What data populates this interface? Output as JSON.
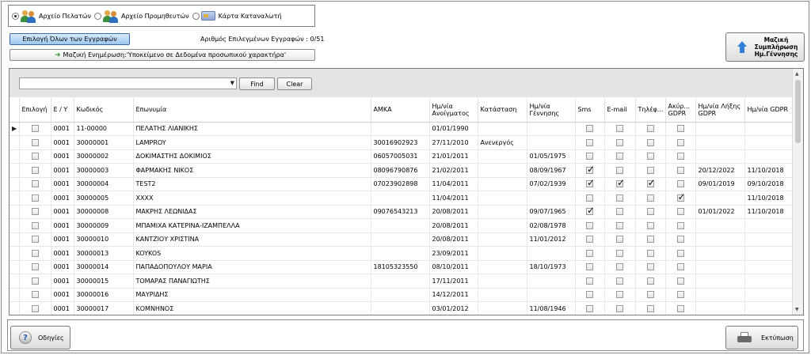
{
  "file_selector": {
    "options": [
      {
        "label": "Αρχείο Πελατών",
        "selected": true,
        "icon": "customers-icon"
      },
      {
        "label": "Αρχείο Προμηθευτών",
        "selected": false,
        "icon": "suppliers-icon"
      },
      {
        "label": "Κάρτα Καταναλωτή",
        "selected": false,
        "icon": "consumer-card-icon"
      }
    ]
  },
  "toolbar": {
    "select_all_label": "Επιλογή Όλων των Εγγραφών",
    "selected_count_label": "Αριθμός Επιλεγμένων Εγγραφών : 0/51",
    "mass_update_label": "Μαζική Ενημέρωση:'Υποκείμενο σε Δεδομένα προσωπικού χαρακτήρα'",
    "birthdate_button_label": "Μαζική Συμπλήρωση Ημ.Γέννησης"
  },
  "filter": {
    "value": "",
    "find_label": "Find",
    "clear_label": "Clear"
  },
  "columns": [
    "Επιλογή",
    "Ε / Υ",
    "Κωδικός",
    "Επωνυμία",
    "ΑΜΚΑ",
    "Ημ/νία Ανοίγματος",
    "Κατάσταση",
    "Ημ/νία Γέννησης",
    "Sms",
    "E-mail",
    "Τηλέφ...",
    "Ακύρ... GDPR",
    "Ημ/νία Λήξης GDPR",
    "Ημ/νία GDPR"
  ],
  "rows": [
    {
      "ey": "0001",
      "code": "11-00000",
      "name": "ΠΕΛΑΤΗΣ ΛΙΑΝΙΚΗΣ",
      "amka": "",
      "opened": "01/01/1990",
      "status": "",
      "birth": "",
      "sms": false,
      "email": false,
      "phone": false,
      "cancel": false,
      "gdpr_end": "",
      "gdpr_date": "",
      "current": true
    },
    {
      "ey": "0001",
      "code": "30000001",
      "name": "LAMPROY",
      "amka": "30016902923",
      "opened": "27/11/2010",
      "status": "Ανενεργός",
      "birth": "",
      "sms": false,
      "email": false,
      "phone": false,
      "cancel": false,
      "gdpr_end": "",
      "gdpr_date": ""
    },
    {
      "ey": "0001",
      "code": "30000002",
      "name": "ΔΟΚΙΜΑΣΤΗΣ ΔΟΚΙΜΙΟΣ",
      "amka": "06057005031",
      "opened": "21/01/2011",
      "status": "",
      "birth": "01/05/1975",
      "sms": false,
      "email": false,
      "phone": false,
      "cancel": false,
      "gdpr_end": "",
      "gdpr_date": ""
    },
    {
      "ey": "0001",
      "code": "30000003",
      "name": "ΦΑΡΜΑΚΗΣ ΝΙΚΟΣ",
      "amka": "08096790876",
      "opened": "21/02/2011",
      "status": "",
      "birth": "08/09/1967",
      "sms": true,
      "email": false,
      "phone": false,
      "cancel": false,
      "gdpr_end": "20/12/2022",
      "gdpr_date": "11/10/2018"
    },
    {
      "ey": "0001",
      "code": "30000004",
      "name": "TEST2",
      "amka": "07023902898",
      "opened": "11/04/2011",
      "status": "",
      "birth": "07/02/1939",
      "sms": true,
      "email": true,
      "phone": true,
      "cancel": false,
      "gdpr_end": "09/01/2019",
      "gdpr_date": "09/10/2018"
    },
    {
      "ey": "0001",
      "code": "30000005",
      "name": "XXXX",
      "amka": "",
      "opened": "11/04/2011",
      "status": "",
      "birth": "",
      "sms": false,
      "email": false,
      "phone": false,
      "cancel": true,
      "gdpr_end": "",
      "gdpr_date": "11/10/2018"
    },
    {
      "ey": "0001",
      "code": "30000008",
      "name": "ΜΑΚΡΗΣ ΛΕΩΝΙΔΑΣ",
      "amka": "09076543213",
      "opened": "20/08/2011",
      "status": "",
      "birth": "09/07/1965",
      "sms": true,
      "email": false,
      "phone": false,
      "cancel": false,
      "gdpr_end": "01/01/2022",
      "gdpr_date": "11/10/2018"
    },
    {
      "ey": "0001",
      "code": "30000009",
      "name": "ΜΠΑΜΙΧΑ ΚΑΤΕΡΙΝΑ-ΙΖΑΜΠΕΛΛΑ",
      "amka": "",
      "opened": "20/08/2011",
      "status": "",
      "birth": "02/08/1978",
      "sms": false,
      "email": false,
      "phone": false,
      "cancel": false,
      "gdpr_end": "",
      "gdpr_date": ""
    },
    {
      "ey": "0001",
      "code": "30000010",
      "name": "ΚΑΝΤΖΙΟΥ ΧΡΙΣΤΙΝΑ",
      "amka": "",
      "opened": "20/08/2011",
      "status": "",
      "birth": "11/01/2012",
      "sms": false,
      "email": false,
      "phone": false,
      "cancel": false,
      "gdpr_end": "",
      "gdpr_date": ""
    },
    {
      "ey": "0001",
      "code": "30000013",
      "name": "KOYKOS",
      "amka": "",
      "opened": "23/09/2011",
      "status": "",
      "birth": "",
      "sms": false,
      "email": false,
      "phone": false,
      "cancel": false,
      "gdpr_end": "",
      "gdpr_date": ""
    },
    {
      "ey": "0001",
      "code": "30000014",
      "name": "ΠΑΠΑΔΟΠΟΥΛΟΥ ΜΑΡΙΑ",
      "amka": "18105323550",
      "opened": "08/10/2011",
      "status": "",
      "birth": "18/10/1973",
      "sms": false,
      "email": false,
      "phone": false,
      "cancel": false,
      "gdpr_end": "",
      "gdpr_date": ""
    },
    {
      "ey": "0001",
      "code": "30000015",
      "name": "ΤΟΜΑΡΑΣ ΠΑΝΑΓΙΩΤΗΣ",
      "amka": "",
      "opened": "17/11/2011",
      "status": "",
      "birth": "",
      "sms": false,
      "email": false,
      "phone": false,
      "cancel": false,
      "gdpr_end": "",
      "gdpr_date": ""
    },
    {
      "ey": "0001",
      "code": "30000016",
      "name": "ΜΑΥΡΙΔΗΣ",
      "amka": "",
      "opened": "14/12/2011",
      "status": "",
      "birth": "",
      "sms": false,
      "email": false,
      "phone": false,
      "cancel": false,
      "gdpr_end": "",
      "gdpr_date": ""
    },
    {
      "ey": "0001",
      "code": "30000017",
      "name": "ΚΟΜΝΗΝΟΣ",
      "amka": "",
      "opened": "03/01/2012",
      "status": "",
      "birth": "11/08/1946",
      "sms": false,
      "email": false,
      "phone": false,
      "cancel": false,
      "gdpr_end": "",
      "gdpr_date": ""
    }
  ],
  "footer": {
    "help_label": "Οδηγίες",
    "print_label": "Εκτύπωση"
  }
}
